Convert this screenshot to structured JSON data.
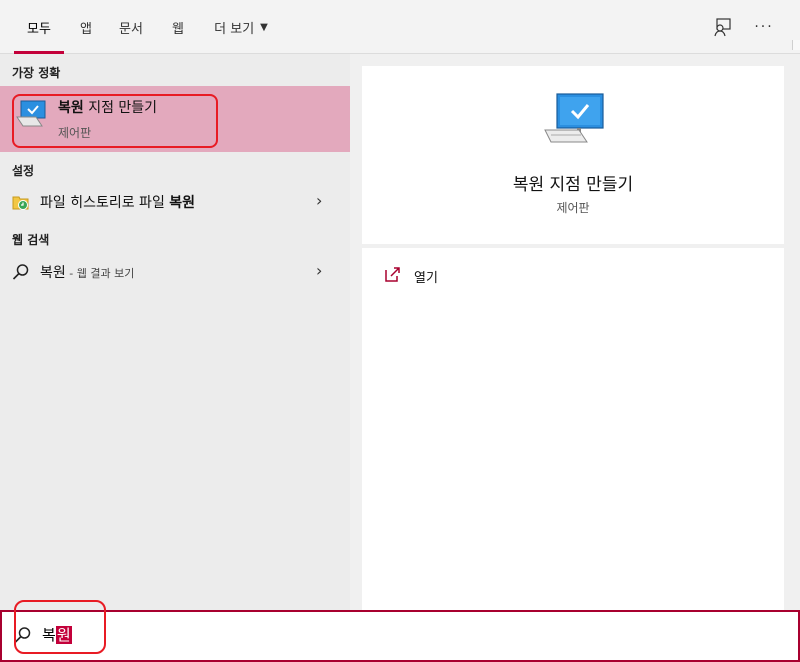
{
  "tabs": [
    {
      "label": "모두",
      "active": true
    },
    {
      "label": "앱"
    },
    {
      "label": "문서"
    },
    {
      "label": "웹"
    },
    {
      "label": "더 보기"
    }
  ],
  "top_icons": {
    "feedback": "feedback-icon",
    "more": "···"
  },
  "sections": {
    "best_match": "가장 정확",
    "settings": "설정",
    "web": "웹 검색"
  },
  "best_match_item": {
    "title_bold": "복원",
    "title_rest": " 지점 만들기",
    "subtitle": "제어판",
    "icon": "monitor-checkmark-icon"
  },
  "settings_item": {
    "label_prefix": "파일 히스토리로 파일 ",
    "label_bold": "복원",
    "icon": "file-history-icon"
  },
  "web_item": {
    "query": "복원",
    "suffix": " - 웹 결과 보기",
    "icon": "search-icon"
  },
  "detail": {
    "title": "복원 지점 만들기",
    "subtitle": "제어판",
    "actions": [
      {
        "label": "열기",
        "icon": "open-icon"
      }
    ]
  },
  "search": {
    "typed": "복",
    "selected": "원"
  },
  "colors": {
    "accent": "#c3003a",
    "highlight": "#e3a9bd",
    "annotation": "#e81b24"
  }
}
